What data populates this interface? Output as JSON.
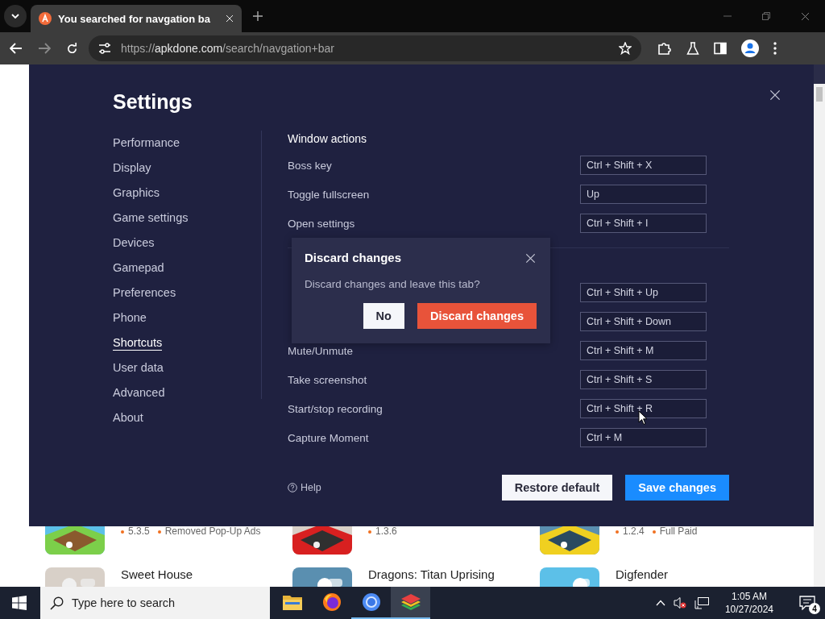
{
  "browser": {
    "tab": {
      "title": "You searched for navgation ba",
      "selected": true
    },
    "address": {
      "scheme": "https://",
      "host": "apkdone.com",
      "path": "/search/navgation+bar"
    }
  },
  "settings": {
    "title": "Settings",
    "nav": [
      {
        "label": "Performance",
        "selected": false
      },
      {
        "label": "Display",
        "selected": false
      },
      {
        "label": "Graphics",
        "selected": false
      },
      {
        "label": "Game settings",
        "selected": false
      },
      {
        "label": "Devices",
        "selected": false
      },
      {
        "label": "Gamepad",
        "selected": false
      },
      {
        "label": "Preferences",
        "selected": false
      },
      {
        "label": "Phone",
        "selected": false
      },
      {
        "label": "Shortcuts",
        "selected": true
      },
      {
        "label": "User data",
        "selected": false
      },
      {
        "label": "Advanced",
        "selected": false
      },
      {
        "label": "About",
        "selected": false
      }
    ],
    "sections": [
      {
        "title": "Window actions",
        "rows": [
          {
            "label": "Boss key",
            "shortcut": "Ctrl + Shift + X"
          },
          {
            "label": "Toggle fullscreen",
            "shortcut": "Up"
          },
          {
            "label": "Open settings",
            "shortcut": "Ctrl + Shift + I"
          }
        ]
      },
      {
        "rows": [
          {
            "shortcut": "Ctrl + Shift + Up"
          },
          {
            "shortcut": "Ctrl + Shift + Down"
          },
          {
            "label": "Mute/Unmute",
            "shortcut": "Ctrl + Shift + M"
          },
          {
            "label": "Take screenshot",
            "shortcut": "Ctrl + Shift + S"
          },
          {
            "label": "Start/stop recording",
            "shortcut": "Ctrl + Shift + R"
          },
          {
            "label": "Capture Moment",
            "shortcut": "Ctrl + M"
          }
        ]
      }
    ],
    "help": "Help",
    "buttons": [
      {
        "label": "Restore default",
        "kind": "secondary"
      },
      {
        "label": "Save changes",
        "kind": "primary"
      }
    ]
  },
  "dialog": {
    "title": "Discard changes",
    "message": "Discard changes and leave this tab?",
    "buttons": [
      {
        "label": "No",
        "kind": "secondary"
      },
      {
        "label": "Discard changes",
        "kind": "danger"
      }
    ]
  },
  "web_cards": [
    {
      "version": "5.3.5",
      "note": "Removed Pop-Up Ads"
    },
    {
      "version": "1.3.6"
    },
    {
      "version": "1.2.4",
      "note": "Full Paid"
    }
  ],
  "web_cards_row_2": [
    {
      "title": "Sweet House"
    },
    {
      "title": "Dragons: Titan Uprising"
    },
    {
      "title": "Digfender"
    }
  ],
  "taskbar": {
    "search_placeholder": "Type here to search",
    "time": "1:05 AM",
    "date": "10/27/2024",
    "notification_count": "4"
  }
}
